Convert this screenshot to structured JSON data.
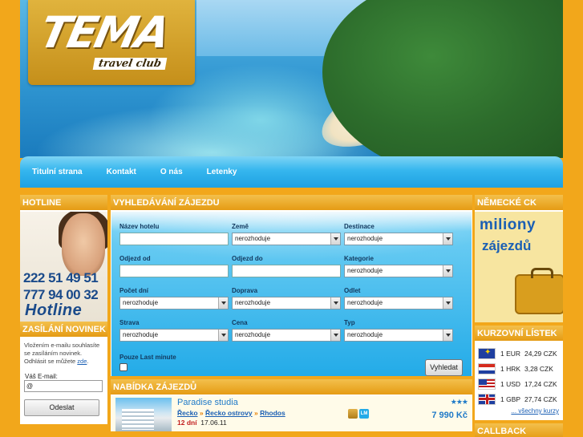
{
  "brand": {
    "logo_text": "TEMA",
    "logo_sub": "travel club"
  },
  "nav": [
    {
      "label": "Titulní strana"
    },
    {
      "label": "Kontakt"
    },
    {
      "label": "O nás"
    },
    {
      "label": "Letenky"
    }
  ],
  "hotline": {
    "title": "HOTLINE",
    "phone1": "222 51 49 51",
    "phone2": "777 94 00 32",
    "label": "Hotline"
  },
  "newsletter": {
    "title": "ZASÍLÁNÍ NOVINEK",
    "note": "Vložením e-mailu souhlasíte se zasíláním novinek. Odhlásit se můžete",
    "link": "zde",
    "email_label": "Váš E-mail:",
    "email_value": "@",
    "submit": "Odeslat"
  },
  "search": {
    "title": "VYHLEDÁVÁNÍ ZÁJEZDU",
    "hotel_label": "Název hotelu",
    "country_label": "Země",
    "country_value": "nerozhoduje",
    "dest_label": "Destinace",
    "dest_value": "nerozhoduje",
    "dep_from_label": "Odjezd od",
    "dep_to_label": "Odjezd do",
    "category_label": "Kategorie",
    "category_value": "nerozhoduje",
    "days_label": "Počet dní",
    "days_value": "nerozhoduje",
    "transport_label": "Doprava",
    "transport_value": "nerozhoduje",
    "departure_label": "Odlet",
    "departure_value": "nerozhoduje",
    "board_label": "Strava",
    "board_value": "nerozhoduje",
    "price_label": "Cena",
    "price_value": "nerozhoduje",
    "type_label": "Typ",
    "type_value": "nerozhoduje",
    "last_minute_label": "Pouze Last minute",
    "submit": "Vyhledat"
  },
  "offers": {
    "title": "NABÍDKA ZÁJEZDŮ",
    "item": {
      "name": "Paradise studia",
      "crumb": [
        "Řecko",
        "Řecko ostrovy",
        "Rhodos"
      ],
      "sep": "»",
      "days": "12 dní",
      "date": "17.06.11",
      "stars": "★★★",
      "price": "7 990 Kč",
      "lm_badge": "LM"
    }
  },
  "german_ck": {
    "title": "NĚMECKÉ CK",
    "ad_line1": "miliony",
    "ad_line2": "zájezdů"
  },
  "rates": {
    "title": "KURZOVNÍ LÍSTEK",
    "items": [
      {
        "flag": "eu-flag-icon",
        "amount": "1 EUR",
        "value": "24,29 CZK"
      },
      {
        "flag": "hr-flag-icon",
        "amount": "1 HRK",
        "value": "3,28 CZK"
      },
      {
        "flag": "us-flag-icon",
        "amount": "1 USD",
        "value": "17,24 CZK"
      },
      {
        "flag": "gb-flag-icon",
        "amount": "1 GBP",
        "value": "27,74 CZK"
      }
    ],
    "more": "... všechny kurzy"
  },
  "callback": {
    "title": "CALLBACK"
  }
}
